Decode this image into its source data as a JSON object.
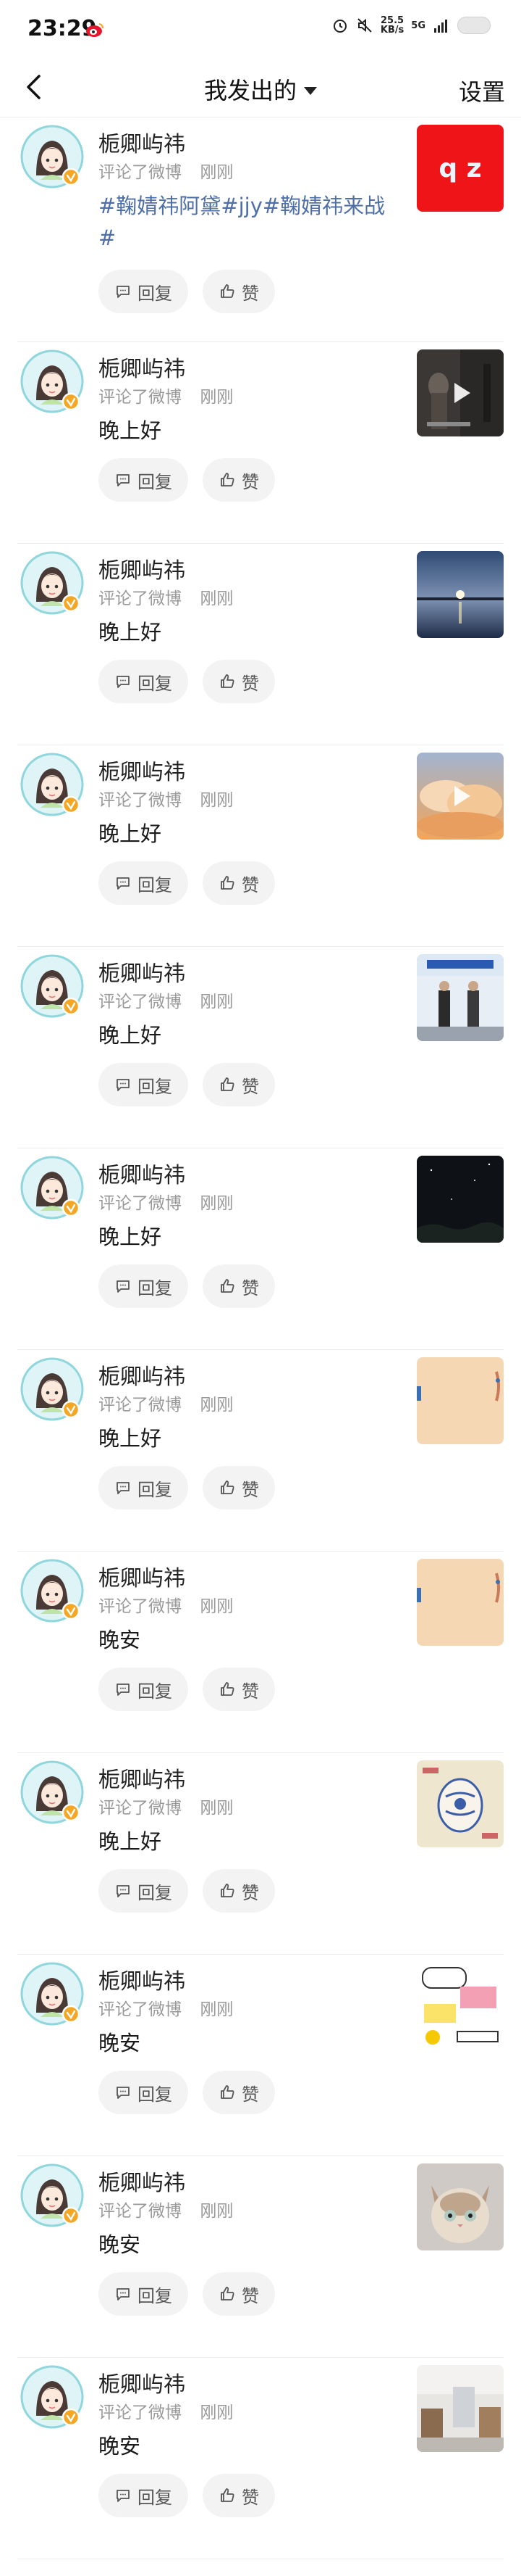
{
  "status_bar": {
    "time": "23:29",
    "speed_value": "25.5",
    "speed_unit": "KB/s",
    "network": "5G"
  },
  "nav": {
    "title": "我发出的",
    "settings_label": "设置"
  },
  "buttons": {
    "reply_label": "回复",
    "like_label": "赞"
  },
  "comments": [
    {
      "user": "栀卿屿祎",
      "action": "评论了微博",
      "time": "刚刚",
      "text": "#鞠婧祎阿黛#jjy#鞠婧祎来战#",
      "thumb": "qz-logo",
      "thumb_text": "q z"
    },
    {
      "user": "栀卿屿祎",
      "action": "评论了微博",
      "time": "刚刚",
      "text": "晚上好",
      "thumb": "video-dark"
    },
    {
      "user": "栀卿屿祎",
      "action": "评论了微博",
      "time": "刚刚",
      "text": "晚上好",
      "thumb": "moon-lake"
    },
    {
      "user": "栀卿屿祎",
      "action": "评论了微博",
      "time": "刚刚",
      "text": "晚上好",
      "thumb": "clouds-video"
    },
    {
      "user": "栀卿屿祎",
      "action": "评论了微博",
      "time": "刚刚",
      "text": "晚上好",
      "thumb": "ceremony-photo"
    },
    {
      "user": "栀卿屿祎",
      "action": "评论了微博",
      "time": "刚刚",
      "text": "晚上好",
      "thumb": "night-sky"
    },
    {
      "user": "栀卿屿祎",
      "action": "评论了微博",
      "time": "刚刚",
      "text": "晚上好",
      "thumb": "skin-beige"
    },
    {
      "user": "栀卿屿祎",
      "action": "评论了微博",
      "time": "刚刚",
      "text": "晚安",
      "thumb": "skin-beige"
    },
    {
      "user": "栀卿屿祎",
      "action": "评论了微博",
      "time": "刚刚",
      "text": "晚上好",
      "thumb": "porcelain-map"
    },
    {
      "user": "栀卿屿祎",
      "action": "评论了微博",
      "time": "刚刚",
      "text": "晚安",
      "thumb": "comic-sticker"
    },
    {
      "user": "栀卿屿祎",
      "action": "评论了微博",
      "time": "刚刚",
      "text": "晚安",
      "thumb": "cat-photo"
    },
    {
      "user": "栀卿屿祎",
      "action": "评论了微博",
      "time": "刚刚",
      "text": "晚安",
      "thumb": "room-photo"
    }
  ],
  "colors": {
    "topic": "#4e6fa8",
    "meta": "#999999",
    "badge": "#f5a623"
  }
}
